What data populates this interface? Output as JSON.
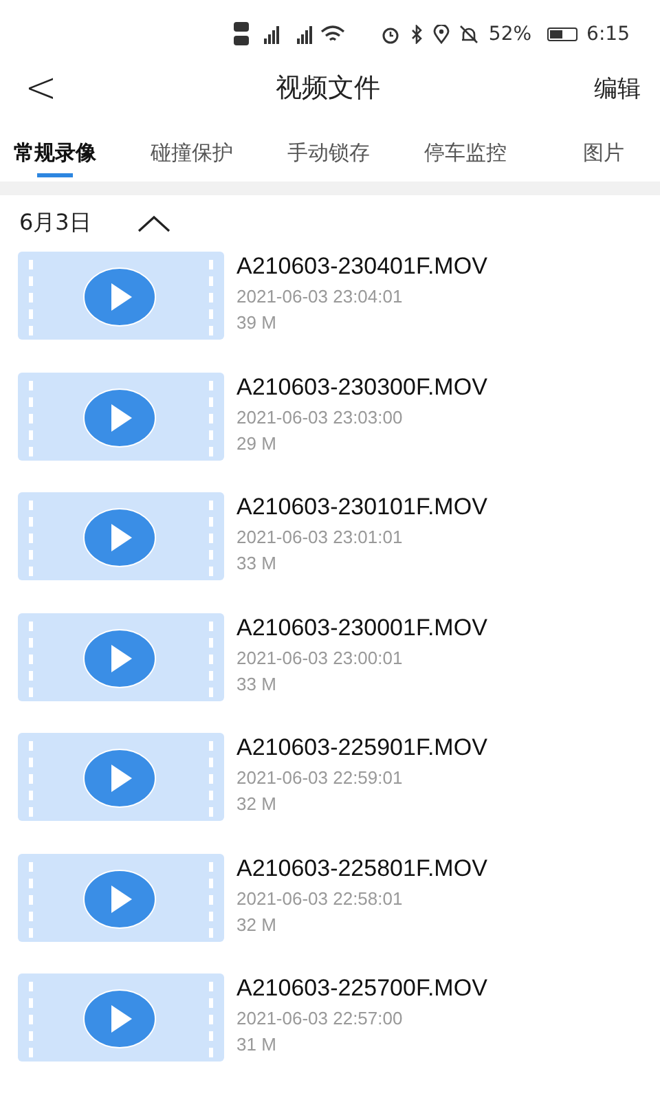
{
  "status_bar": {
    "battery_percent": "52%",
    "time": "6:15"
  },
  "header": {
    "back": "<",
    "title": "视频文件",
    "action": "编辑"
  },
  "tabs": [
    {
      "label": "常规录像",
      "selected": true
    },
    {
      "label": "碰撞保护",
      "selected": false
    },
    {
      "label": "手动锁存",
      "selected": false
    },
    {
      "label": "停车监控",
      "selected": false
    },
    {
      "label": "图片",
      "selected": false
    }
  ],
  "group": {
    "date": "6月3日",
    "expanded": true
  },
  "files": [
    {
      "name": "A210603-230401F.MOV",
      "time": "2021-06-03 23:04:01",
      "size": "39 M"
    },
    {
      "name": "A210603-230300F.MOV",
      "time": "2021-06-03 23:03:00",
      "size": "29 M"
    },
    {
      "name": "A210603-230101F.MOV",
      "time": "2021-06-03 23:01:01",
      "size": "33 M"
    },
    {
      "name": "A210603-230001F.MOV",
      "time": "2021-06-03 23:00:01",
      "size": "33 M"
    },
    {
      "name": "A210603-225901F.MOV",
      "time": "2021-06-03 22:59:01",
      "size": "32 M"
    },
    {
      "name": "A210603-225801F.MOV",
      "time": "2021-06-03 22:58:01",
      "size": "32 M"
    },
    {
      "name": "A210603-225700F.MOV",
      "time": "2021-06-03 22:57:00",
      "size": "31 M"
    }
  ]
}
